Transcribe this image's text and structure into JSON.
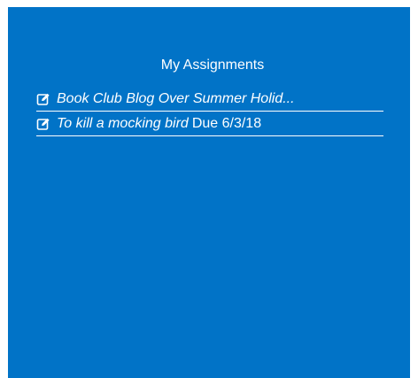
{
  "panel": {
    "title": "My Assignments",
    "background_color": "#0173c7",
    "text_color": "#ffffff"
  },
  "assignments": [
    {
      "icon": "edit-icon",
      "name": "Book Club Blog Over Summer Holid...",
      "due": ""
    },
    {
      "icon": "edit-icon",
      "name": "To kill a mocking bird",
      "due": "Due 6/3/18"
    }
  ]
}
